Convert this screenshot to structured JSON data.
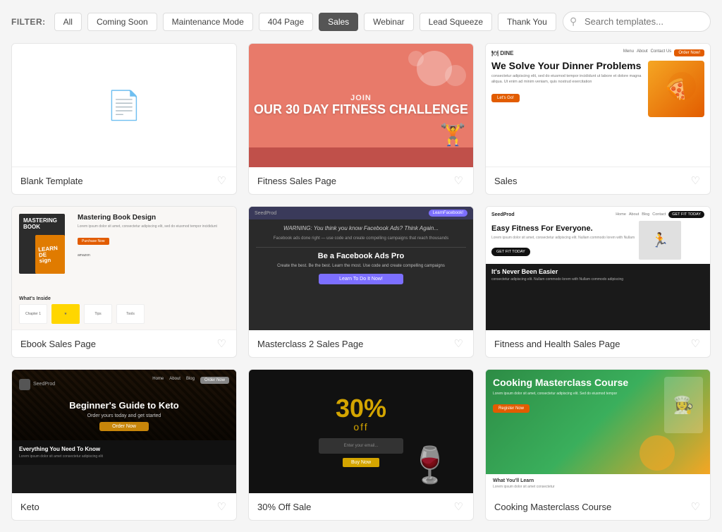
{
  "filter": {
    "label": "FILTER:",
    "buttons": [
      {
        "id": "all",
        "label": "All",
        "active": false
      },
      {
        "id": "coming-soon",
        "label": "Coming Soon",
        "active": false
      },
      {
        "id": "maintenance",
        "label": "Maintenance Mode",
        "active": false
      },
      {
        "id": "404",
        "label": "404 Page",
        "active": false
      },
      {
        "id": "sales",
        "label": "Sales",
        "active": true
      },
      {
        "id": "webinar",
        "label": "Webinar",
        "active": false
      },
      {
        "id": "lead-squeeze",
        "label": "Lead Squeeze",
        "active": false
      },
      {
        "id": "thank-you",
        "label": "Thank You",
        "active": false
      }
    ]
  },
  "search": {
    "placeholder": "Search templates..."
  },
  "templates": [
    {
      "id": "blank",
      "title": "Blank Template",
      "type": "blank"
    },
    {
      "id": "fitness-sales",
      "title": "Fitness Sales Page",
      "type": "fitness",
      "join_text": "JOIN",
      "main_text": "OUR 30 DAY FITNESS CHALLENGE"
    },
    {
      "id": "sales",
      "title": "Sales",
      "type": "sales",
      "headline": "We Solve Your Dinner Problems",
      "cta": "Let's Go!"
    },
    {
      "id": "ebook-sales",
      "title": "Ebook Sales Page",
      "type": "ebook",
      "book_title": "MASTERING BOOK",
      "learn_title": "LEARN DE sign",
      "section_title": "What's Inside"
    },
    {
      "id": "masterclass2",
      "title": "Masterclass 2 Sales Page",
      "type": "masterclass",
      "warning": "WARNING: You think you know Facebook Ads? Think Again...",
      "headline": "Be a Facebook Ads Pro",
      "cta": "Learn To Do It Now!"
    },
    {
      "id": "fitness-health",
      "title": "Fitness and Health Sales Page",
      "type": "fitness-health",
      "headline": "Easy Fitness For Everyone.",
      "cta": "GET FIT TODAY",
      "dark_headline": "It's Never Been Easier"
    },
    {
      "id": "keto",
      "title": "Keto",
      "type": "keto",
      "brand": "SeedProd",
      "headline": "Beginner's Guide to Keto",
      "sub": "Everything You Need To Know",
      "cta": "Order Now"
    },
    {
      "id": "sale-30",
      "title": "30% Off Sale",
      "type": "sale",
      "percent": "30%",
      "off_text": "off",
      "cta": "Buy Now"
    },
    {
      "id": "cooking",
      "title": "Cooking Masterclass Course",
      "type": "cooking",
      "headline": "Cooking Masterclass Course",
      "cta": "Register Now",
      "bottom_title": "What You'll Learn"
    }
  ]
}
